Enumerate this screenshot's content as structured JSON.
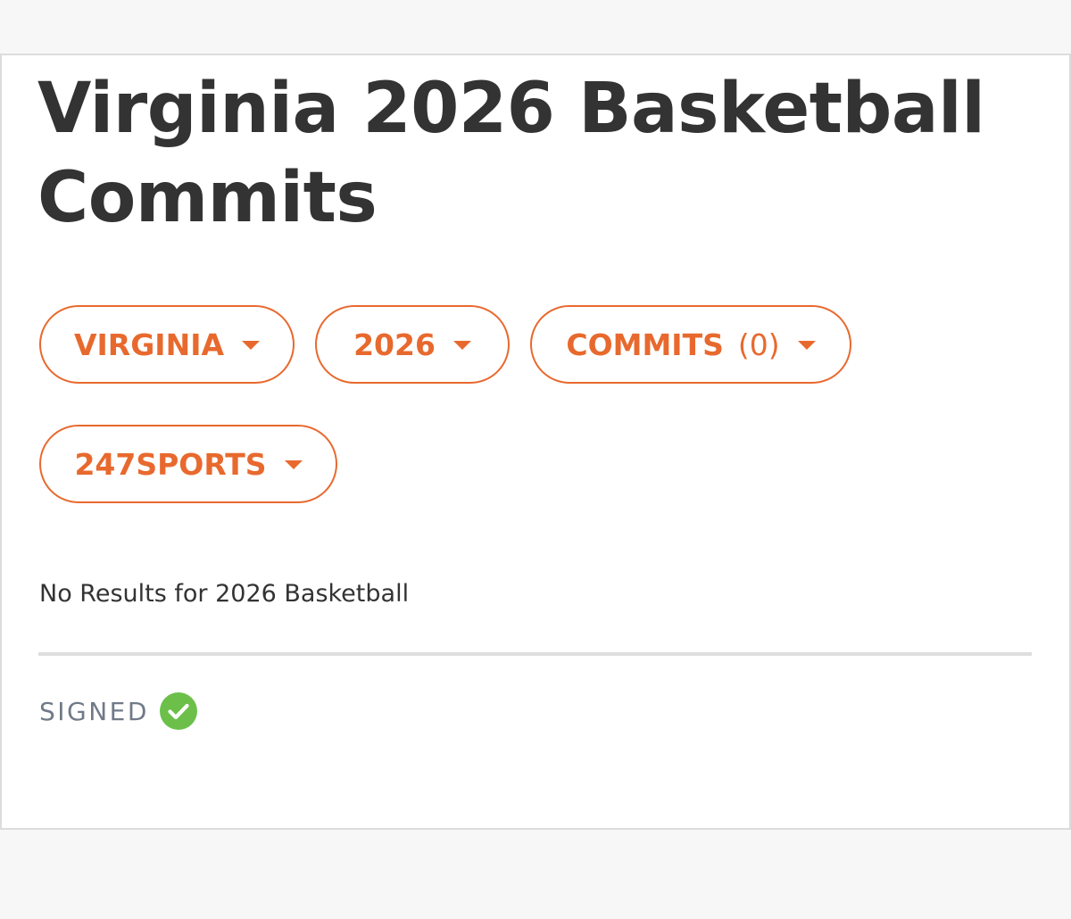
{
  "page": {
    "title": "Virginia 2026 Basketball Commits"
  },
  "filters": {
    "team": {
      "label": "VIRGINIA"
    },
    "year": {
      "label": "2026"
    },
    "type": {
      "label": "COMMITS",
      "count": "(0)"
    },
    "source": {
      "label": "247SPORTS"
    }
  },
  "results": {
    "empty_message": "No Results for 2026 Basketball"
  },
  "legend": {
    "signed_label": "SIGNED",
    "signed_icon": "check-circle-icon"
  },
  "colors": {
    "accent": "#e8692e",
    "signed_green": "#6cc04a",
    "title_text": "#333333"
  }
}
